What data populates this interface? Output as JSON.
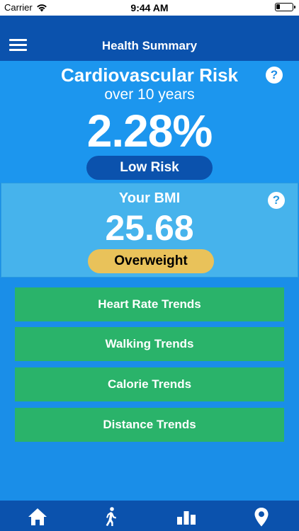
{
  "status": {
    "carrier": "Carrier",
    "time": "9:44 AM"
  },
  "nav": {
    "title": "Health Summary"
  },
  "cardio": {
    "title": "Cardiovascular Risk",
    "subtitle": "over 10 years",
    "value": "2.28%",
    "risk_label": "Low Risk",
    "help": "?"
  },
  "bmi": {
    "title": "Your BMI",
    "value": "25.68",
    "category": "Overweight",
    "help": "?"
  },
  "trends": {
    "heart_rate": "Heart Rate Trends",
    "walking": "Walking Trends",
    "calorie": "Calorie Trends",
    "distance": "Distance Trends"
  },
  "tabs": [
    "home-icon",
    "walking-icon",
    "bar-chart-icon",
    "location-pin-icon"
  ],
  "colors": {
    "nav": "#0b52ad",
    "background": "#1a8ee8",
    "bmi_panel": "#46b3ec",
    "button": "#2ab36a",
    "overweight": "#e9c25a"
  }
}
